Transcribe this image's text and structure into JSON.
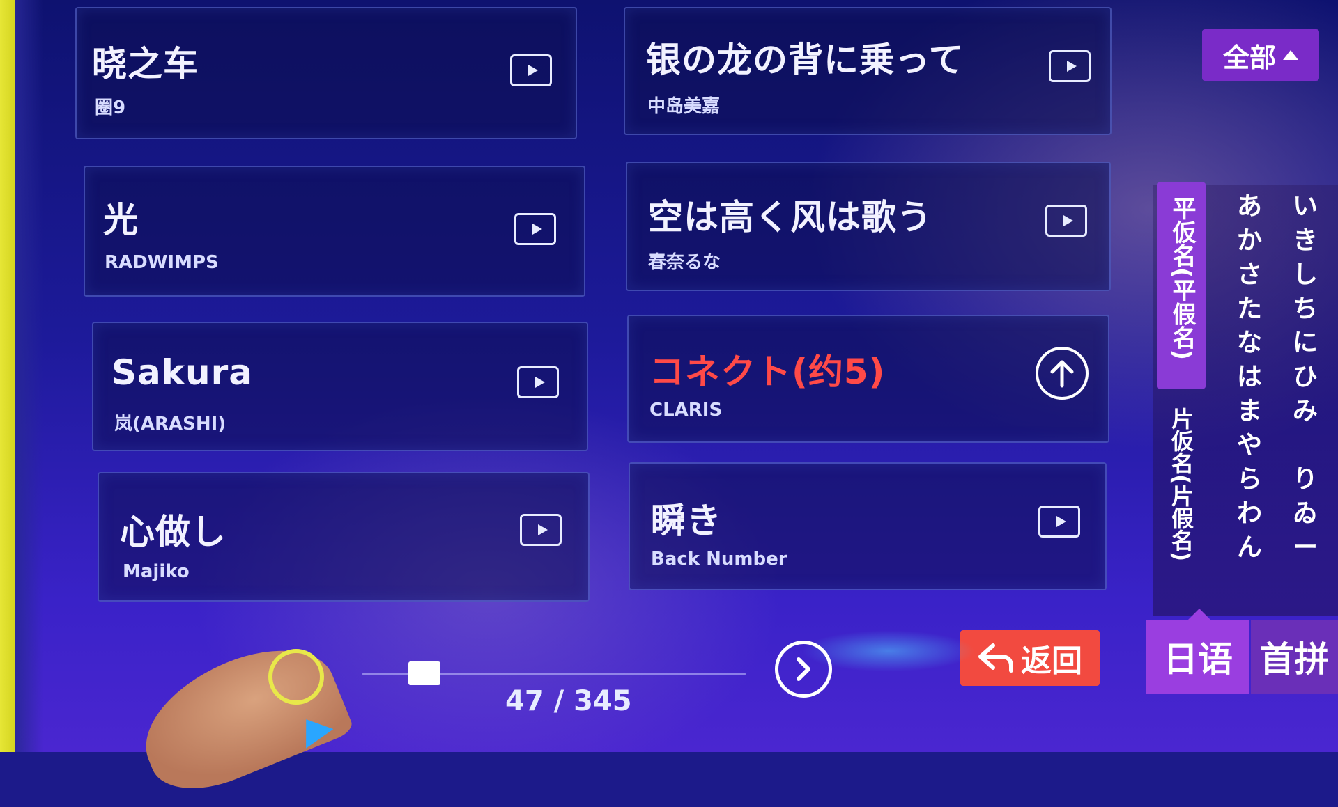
{
  "filter": {
    "label": "全部"
  },
  "songs": [
    {
      "title": "晓之车",
      "artist": "圈9"
    },
    {
      "title": "银の龙の背に乗って",
      "artist": "中岛美嘉"
    },
    {
      "title": "光",
      "artist": "RADWIMPS"
    },
    {
      "title": "空は高く风は歌う",
      "artist": "春奈るな"
    },
    {
      "title": "Sakura",
      "artist": "岚(ARASHI)"
    },
    {
      "title": "コネクト(约5)",
      "artist": "CLARIS"
    },
    {
      "title": "心做し",
      "artist": "Majiko"
    },
    {
      "title": "瞬き",
      "artist": "Back Number"
    }
  ],
  "kana_tabs": {
    "hiragana": "平仮名(平假名)",
    "katakana": "片仮名(片假名)"
  },
  "kana_columns": [
    [
      "あ",
      "か",
      "さ",
      "た",
      "な",
      "は",
      "ま",
      "や",
      "ら",
      "わ",
      "ん"
    ],
    [
      "い",
      "き",
      "し",
      "ち",
      "に",
      "ひ",
      "み",
      "",
      "り",
      "ゐ",
      "ー"
    ]
  ],
  "lang_tabs": {
    "active": "日语",
    "other": "首拼"
  },
  "actions": {
    "return_label": "返回"
  },
  "pagination": {
    "counter": "47 / 345",
    "current": 47,
    "total": 345
  },
  "colors": {
    "accent_purple": "#8a3bd6",
    "highlight_red": "#ff4a48",
    "return_red": "#f24a40"
  }
}
